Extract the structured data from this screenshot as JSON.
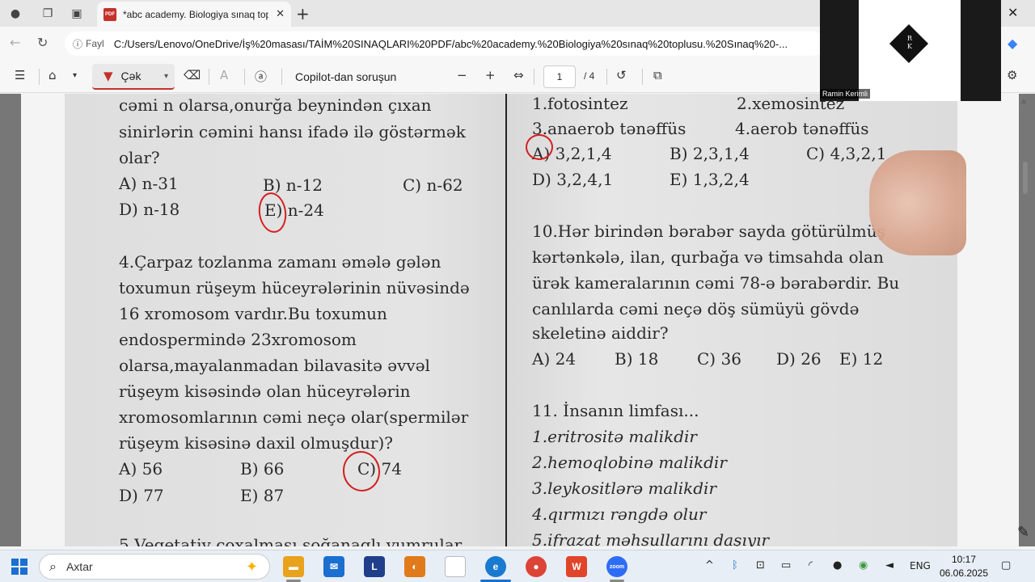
{
  "browser": {
    "tab_title": "*abc academy. Biologiya sınaq top",
    "address_label": "Fayl",
    "url": "C:/Users/Lenovo/OneDrive/İş%20masası/TAİM%20SINAQLARI%20PDF/abc%20academy.%20Biologiya%20sınaq%20toplusu.%20Sınaq%20-..."
  },
  "pdf_toolbar": {
    "draw_label": "Çək",
    "copilot_label": "Copilot-dan soruşun",
    "current_page": "1",
    "total_pages": "/ 4"
  },
  "webcam": {
    "logo_letters": "R\nK",
    "participant": "Ramin Kerimli"
  },
  "document": {
    "left": {
      "q3_line1": "cəmi n olarsa,onurğa beynindən çıxan",
      "q3_line2": "sinirlərin cəmini hansı ifadə ilə göstərmək",
      "q3_line3": "olar?",
      "q3_a": "A) n-31",
      "q3_b": "B) n-12",
      "q3_c": "C) n-62",
      "q3_d": "D) n-18",
      "q3_e": "E) n-24",
      "q4_line1": "4.Çarpaz tozlanma zamanı əmələ gələn",
      "q4_line2": "toxumun rüşeym hüceyrələrinin nüvəsində",
      "q4_line3": "16 xromosom vardır.Bu toxumun",
      "q4_line4": "endospermində 23xromosom",
      "q4_line5": "olarsa,mayalanmadan bilavasitə əvvəl",
      "q4_line6": "rüşeym kisəsində olan hüceyrələrin",
      "q4_line7": "xromosomlarının cəmi neçə olar(spermilər",
      "q4_line8": "rüşeym kisəsinə daxil olmuşdur)?",
      "q4_a": "A) 56",
      "q4_b": "B) 66",
      "q4_c": "C) 74",
      "q4_d": "D) 77",
      "q4_e": "E) 87",
      "q5_partial": "5.Vegetativ çoxalması soğanaqlı yumrular"
    },
    "right": {
      "q9_opt1": "1.fotosintez",
      "q9_opt2": "2.xemosintez",
      "q9_opt3": "3.anaerob tənəffüs",
      "q9_opt4": "4.aerob tənəffüs",
      "q9_a": "A) 3,2,1,4",
      "q9_b": "B) 2,3,1,4",
      "q9_c": "C) 4,3,2,1",
      "q9_d": "D) 3,2,4,1",
      "q9_e": "E) 1,3,2,4",
      "q10_line1": "10.Hər birindən bərabər sayda götürülmüş",
      "q10_line2": "kərtənkələ, ilan, qurbağa və timsahda olan",
      "q10_line3": "ürək kameralarının cəmi 78-ə bərabərdir. Bu",
      "q10_line4": "canlılarda cəmi neçə döş sümüyü gövdə",
      "q10_line5": "skeletinə aiddir?",
      "q10_a": "A) 24",
      "q10_b": "B) 18",
      "q10_c": "C) 36",
      "q10_d": "D) 26",
      "q10_e": "E) 12",
      "q11_title": "11. İnsanın limfası...",
      "q11_1": "1.eritrositə malikdir",
      "q11_2": "2.hemoqlobinə malikdir",
      "q11_3": "3.leykositlərə malikdir",
      "q11_4": "4.qırmızı rəngdə olur",
      "q11_5": "5.ifrazat məhsullarını daşıyır"
    }
  },
  "taskbar": {
    "search_placeholder": "Axtar",
    "language": "ENG",
    "time": "10:17",
    "date": "06.06.2025"
  }
}
